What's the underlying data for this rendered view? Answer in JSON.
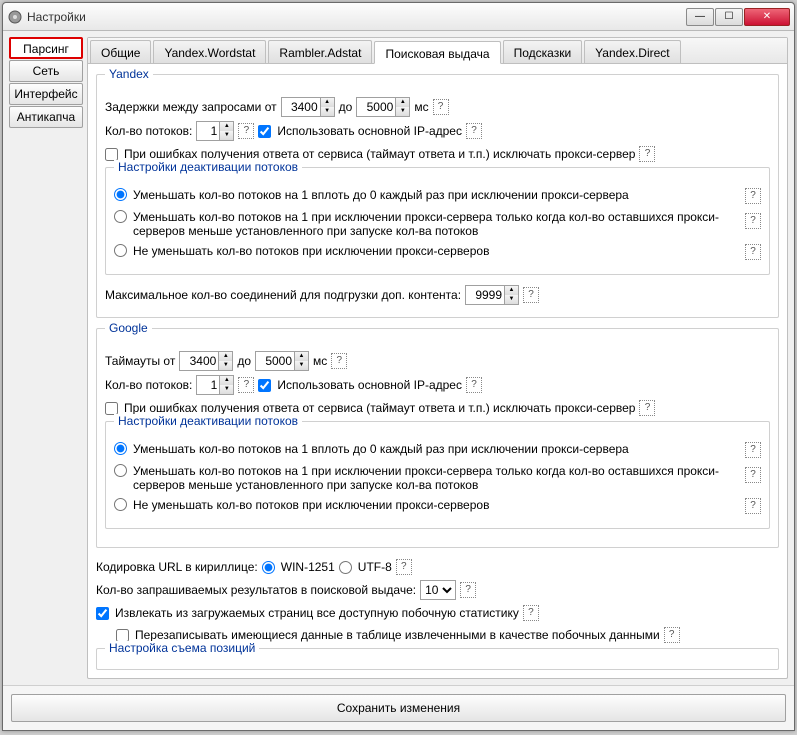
{
  "window": {
    "title": "Настройки"
  },
  "sidebar": {
    "items": [
      {
        "label": "Парсинг",
        "active": true
      },
      {
        "label": "Сеть"
      },
      {
        "label": "Интерфейс"
      },
      {
        "label": "Антикапча"
      }
    ]
  },
  "tabs": {
    "items": [
      {
        "label": "Общие"
      },
      {
        "label": "Yandex.Wordstat"
      },
      {
        "label": "Rambler.Adstat"
      },
      {
        "label": "Поисковая выдача",
        "active": true
      },
      {
        "label": "Подсказки"
      },
      {
        "label": "Yandex.Direct"
      }
    ]
  },
  "yandex": {
    "title": "Yandex",
    "delay_label_pre": "Задержки между запросами от",
    "delay_from": "3400",
    "delay_to_label": "до",
    "delay_to": "5000",
    "delay_unit": "мс",
    "threads_label": "Кол-во потоков:",
    "threads": "1",
    "use_main_ip": "Использовать основной IP-адрес",
    "exclude_proxy": "При ошибках получения ответа от сервиса (таймаут ответа и т.п.) исключать прокси-сервер",
    "deact_title": "Настройки деактивации потоков",
    "deact_opt1": "Уменьшать кол-во потоков на 1 вплоть до 0 каждый раз при исключении прокси-сервера",
    "deact_opt2": "Уменьшать кол-во потоков на 1 при исключении прокси-сервера только когда кол-во оставшихся прокси-серверов меньше установленного при запуске кол-ва потоков",
    "deact_opt3": "Не уменьшать кол-во потоков при исключении прокси-серверов",
    "max_conn_label": "Максимальное кол-во соединений для подгрузки доп. контента:",
    "max_conn": "9999"
  },
  "google": {
    "title": "Google",
    "timeout_label_pre": "Таймауты от",
    "timeout_from": "3400",
    "timeout_to_label": "до",
    "timeout_to": "5000",
    "timeout_unit": "мс",
    "threads_label": "Кол-во потоков:",
    "threads": "1",
    "use_main_ip": "Использовать основной IP-адрес",
    "exclude_proxy": "При ошибках получения ответа от сервиса (таймаут ответа и т.п.) исключать прокси-сервер",
    "deact_title": "Настройки деактивации потоков",
    "deact_opt1": "Уменьшать кол-во потоков на 1 вплоть до 0 каждый раз при исключении прокси-сервера",
    "deact_opt2": "Уменьшать кол-во потоков на 1 при исключении прокси-сервера только когда кол-во оставшихся прокси-серверов меньше установленного при запуске кол-ва потоков",
    "deact_opt3": "Не уменьшать кол-во потоков при исключении прокси-серверов"
  },
  "encoding": {
    "label": "Кодировка URL в кириллице:",
    "opt1": "WIN-1251",
    "opt2": "UTF-8"
  },
  "results": {
    "label": "Кол-во запрашиваемых результатов в поисковой выдаче:",
    "value": "10"
  },
  "extract": {
    "label": "Извлекать из загружаемых страниц все доступную побочную статистику",
    "sub": "Перезаписывать имеющиеся данные в таблице извлеченными в качестве побочных данными"
  },
  "positions": {
    "title": "Настройка съема позиций"
  },
  "footer": {
    "save": "Сохранить изменения"
  }
}
